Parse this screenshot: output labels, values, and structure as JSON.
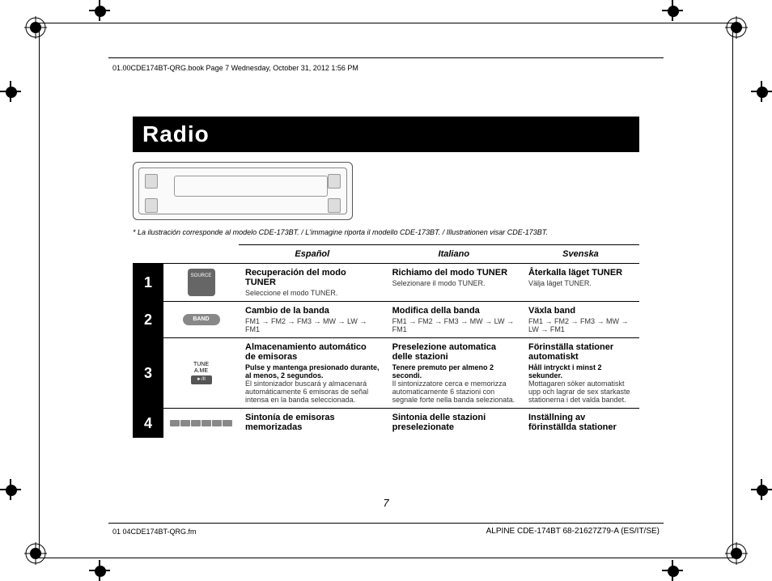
{
  "header_text": "01.00CDE174BT-QRG.book  Page 7  Wednesday, October 31, 2012  1:56 PM",
  "footer_left": "01 04CDE174BT-QRG.fm",
  "footer_right": "ALPINE CDE-174BT 68-21627Z79-A (ES/IT/SE)",
  "page_number": "7",
  "title": "Radio",
  "caption": "* La ilustración corresponde al modelo CDE-173BT. / L'immagine riporta il modello CDE-173BT. / Illustrationen visar CDE-173BT.",
  "lang": {
    "es": "Español",
    "it": "Italiano",
    "sv": "Svenska"
  },
  "icons": {
    "source": "SOURCE",
    "band": "BAND",
    "tune1": "TUNE",
    "tune2": "A.ME",
    "play": "►/II"
  },
  "rows": {
    "1": {
      "es": {
        "t": "Recuperación del modo TUNER",
        "b": "Seleccione el modo TUNER."
      },
      "it": {
        "t": "Richiamo del modo TUNER",
        "b": "Selezionare il modo TUNER."
      },
      "sv": {
        "t": "Återkalla läget TUNER",
        "b": "Välja läget TUNER."
      }
    },
    "2": {
      "es": {
        "t": "Cambio de la banda",
        "b": "FM1 → FM2 → FM3 → MW → LW → FM1"
      },
      "it": {
        "t": "Modifica della banda",
        "b": "FM1 → FM2 → FM3 → MW → LW → FM1"
      },
      "sv": {
        "t": "Växla band",
        "b": "FM1 → FM2 → FM3 → MW → LW → FM1"
      }
    },
    "3": {
      "es": {
        "t": "Almacenamiento automático de emisoras",
        "s": "Pulse y mantenga presionado durante, al menos, 2 segundos.",
        "b": "El sintonizador buscará y almacenará automáticamente 6 emisoras de señal intensa en la banda seleccionada."
      },
      "it": {
        "t": "Preselezione automatica delle stazioni",
        "s": "Tenere premuto per almeno 2 secondi.",
        "b": "Il sintonizzatore cerca e memorizza automaticamente 6 stazioni con segnale forte nella banda selezionata."
      },
      "sv": {
        "t": "Förinställa stationer automatiskt",
        "s": "Håll intryckt i minst 2 sekunder.",
        "b": "Mottagaren söker automatiskt upp och lagrar de sex starkaste stationerna i det valda bandet."
      }
    },
    "4": {
      "es": {
        "t": "Sintonía de emisoras memorizadas"
      },
      "it": {
        "t": "Sintonia delle stazioni preselezionate"
      },
      "sv": {
        "t": "Inställning av förinställda stationer"
      }
    }
  }
}
